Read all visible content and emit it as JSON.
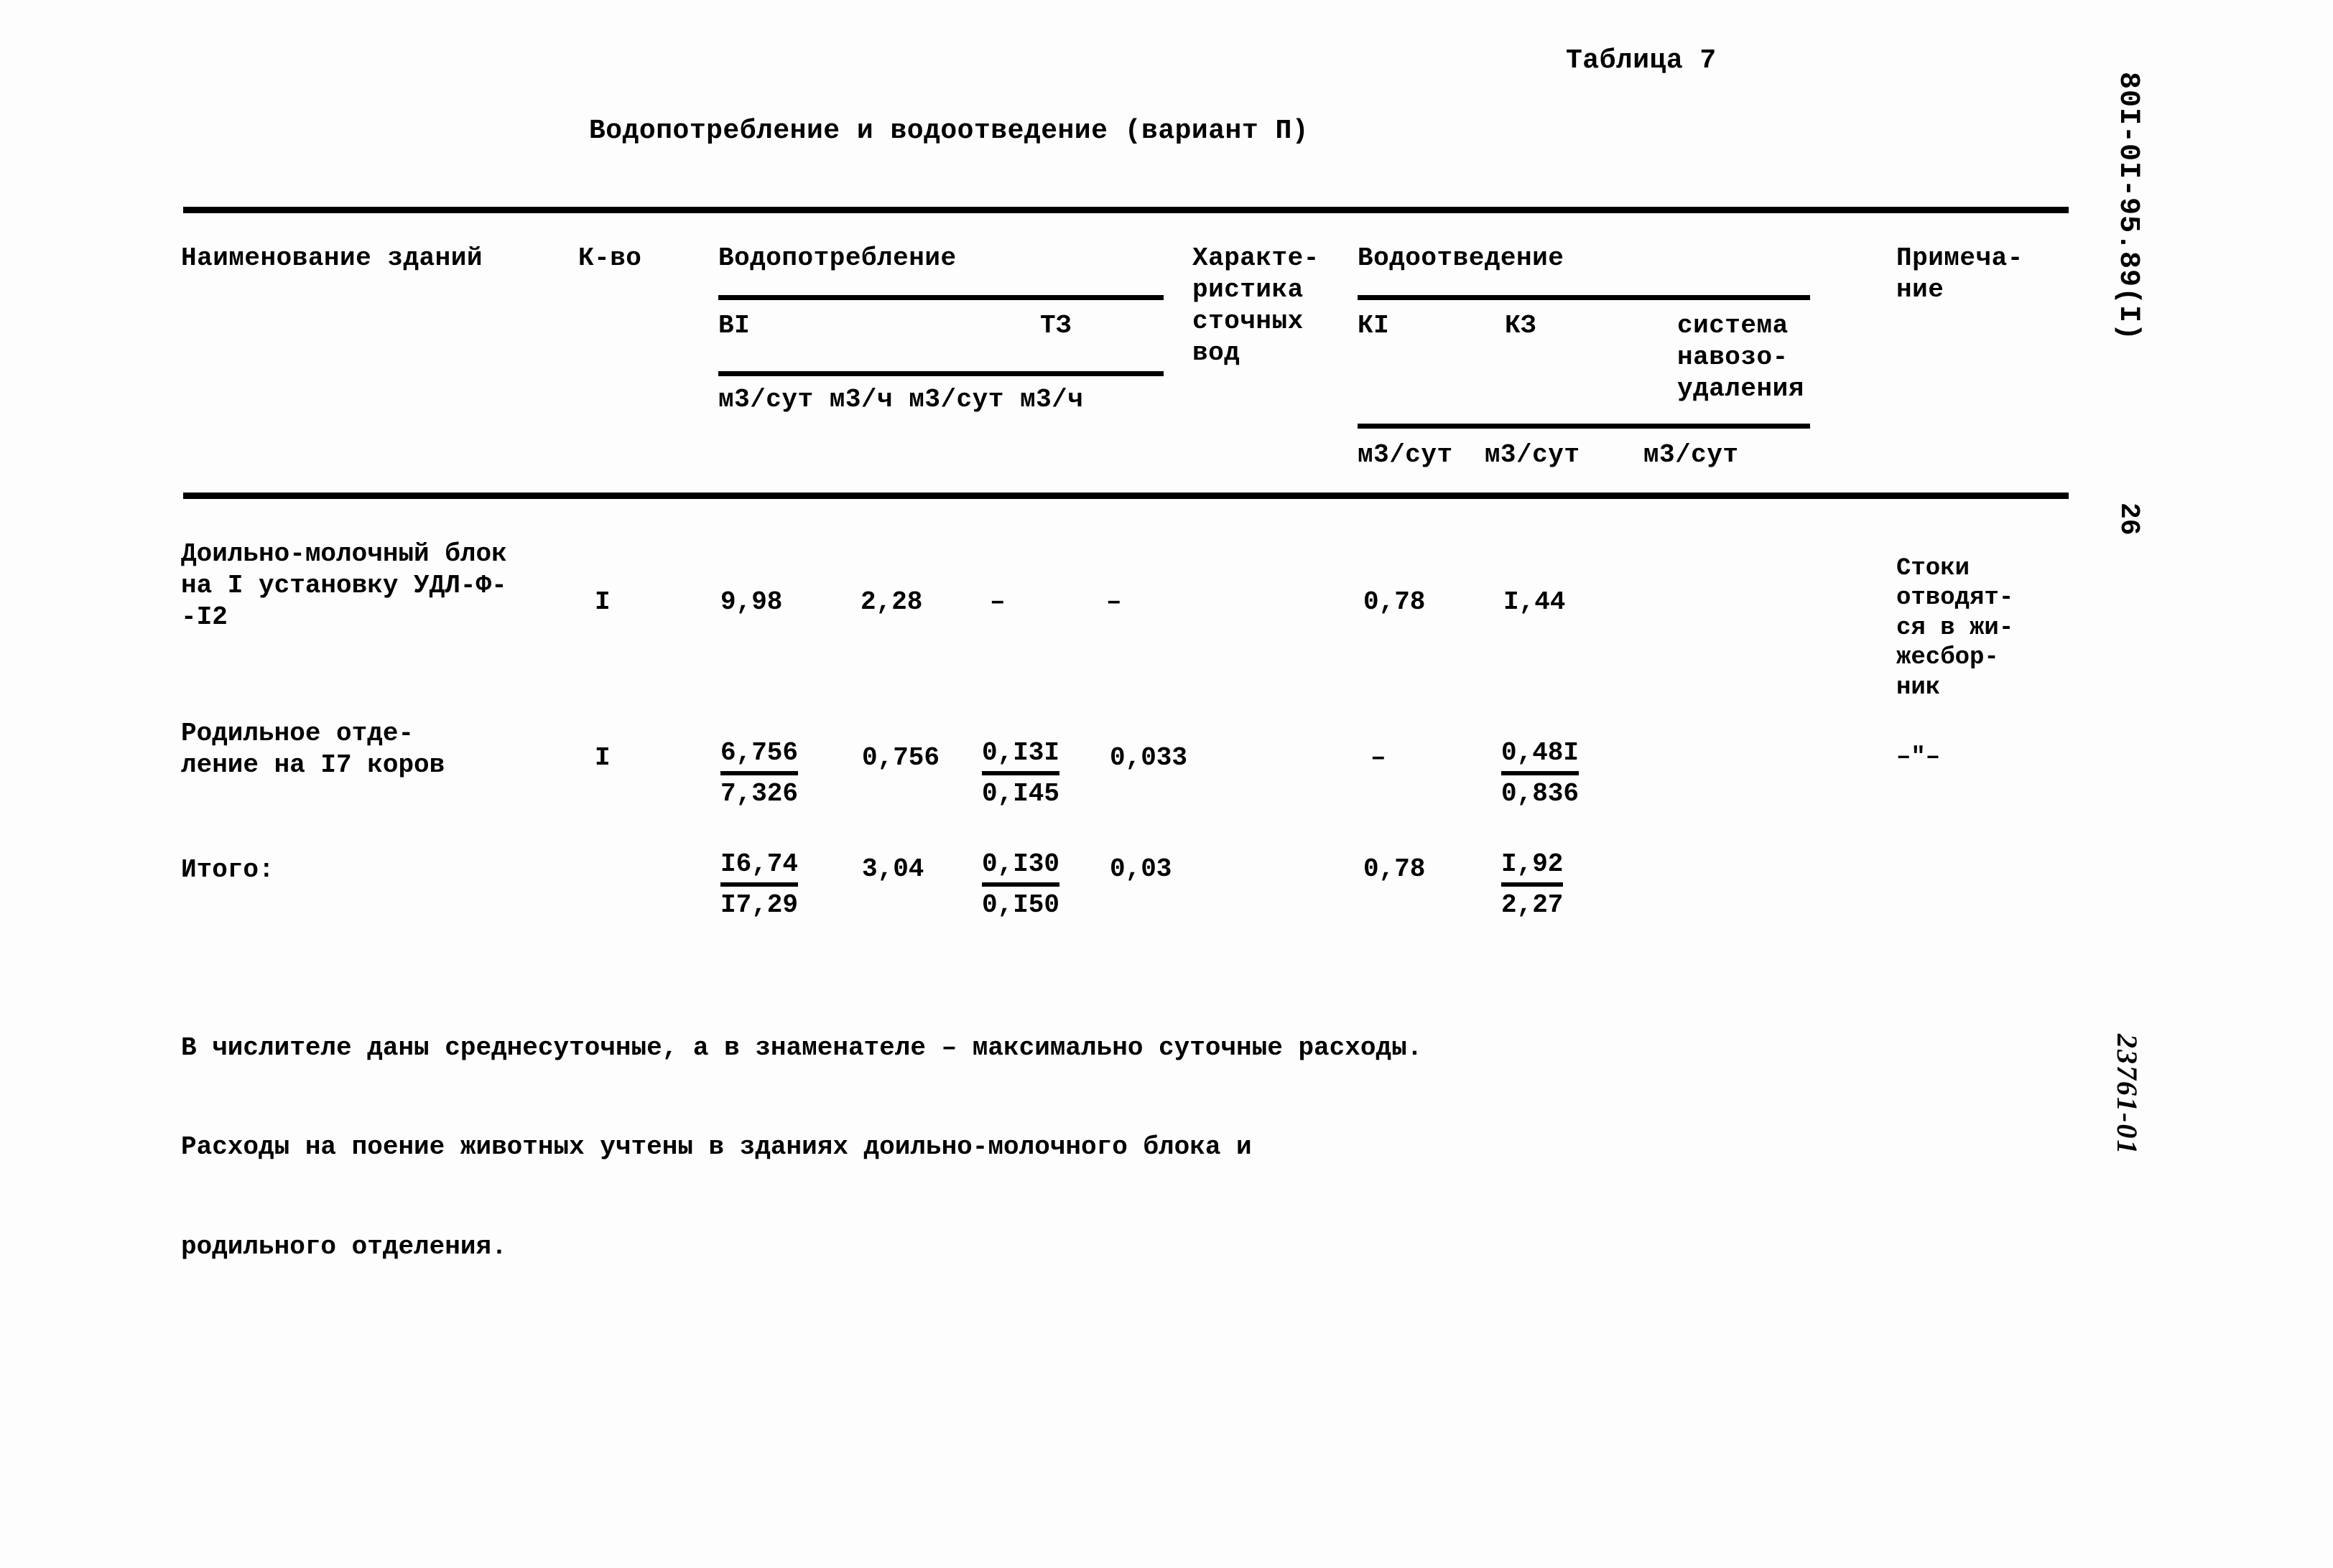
{
  "document": {
    "table_number": "Таблица 7",
    "table_title": "Водопотребление и водоотведение (вариант П)",
    "margin_code": "80I-0I-95.89(I)",
    "page_number": "26",
    "margin_stamp": "23761-01"
  },
  "header": {
    "name": "Наименование зданий",
    "count": "К-во",
    "water_supply": "Водопотребление",
    "ws_sub_1": "ВI",
    "ws_sub_2": "ТЗ",
    "ws_units": "м3/сут м3/ч м3/сут м3/ч",
    "characteristic": "Характе-\nристика\nсточных\nвод",
    "water_disposal": "Водоотведение",
    "wd_sub_1": "КI",
    "wd_sub_2": "КЗ",
    "wd_sub_3": "система\nнавозо-\nудаления",
    "wd_units": "м3/сут  м3/сут    м3/сут",
    "note": "Примеча-\nние"
  },
  "rows": [
    {
      "name": "Доильно-молочный блок\nна I установку УДЛ-Ф-\n-I2",
      "count": "I",
      "ws_b1_sut": "9,98",
      "ws_b1_ch": "2,28",
      "ws_t3_sut": "–",
      "ws_t3_ch": "–",
      "wd_k1": "0,78",
      "wd_k3": "I,44",
      "note": "Стоки\nотводят-\nся в жи-\nжесбор-\nник"
    },
    {
      "name": "Родильное отде-\nление на I7 коров",
      "count": "I",
      "ws_b1_sut_num": "6,756",
      "ws_b1_sut_den": "7,326",
      "ws_b1_ch": "0,756",
      "ws_t3_sut_num": "0,I3I",
      "ws_t3_sut_den": "0,I45",
      "ws_t3_ch": "0,033",
      "wd_k1": "–",
      "wd_k3_num": "0,48I",
      "wd_k3_den": "0,836",
      "note": "–\"–"
    },
    {
      "name": "Итого:",
      "count": "",
      "ws_b1_sut_num": "I6,74",
      "ws_b1_sut_den": "I7,29",
      "ws_b1_ch": "3,04",
      "ws_t3_sut_num": "0,I30",
      "ws_t3_sut_den": "0,I50",
      "ws_t3_ch": "0,03",
      "wd_k1": "0,78",
      "wd_k3_num": "I,92",
      "wd_k3_den": "2,27",
      "note": ""
    }
  ],
  "footnotes": {
    "line1": "В числителе даны среднесуточные, а в знаменателе – максимально суточные расходы.",
    "line2": "Расходы на поение животных учтены в зданиях доильно-молочного блока и",
    "line3": "родильного отделения."
  }
}
